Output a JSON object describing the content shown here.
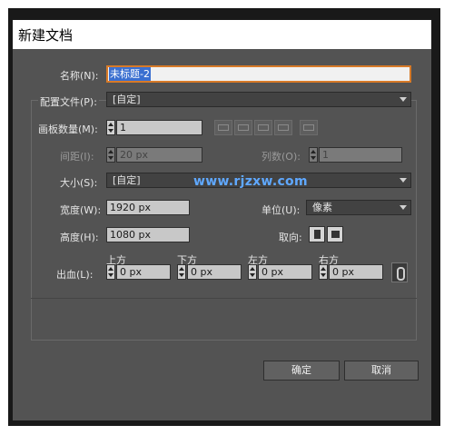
{
  "window": {
    "title": "新建文档"
  },
  "form": {
    "name": {
      "label": "名称(N):",
      "value": "未标题-2"
    },
    "profile": {
      "label": "配置文件(P):",
      "value": "[自定]"
    },
    "artboards": {
      "label": "画板数量(M):",
      "value": "1"
    },
    "spacing": {
      "label": "间距(I):",
      "value": "20 px"
    },
    "columns": {
      "label": "列数(O):",
      "value": "1"
    },
    "size": {
      "label": "大小(S):",
      "value": "[自定]"
    },
    "width": {
      "label": "宽度(W):",
      "value": "1920 px"
    },
    "units": {
      "label": "单位(U):",
      "value": "像素"
    },
    "height": {
      "label": "高度(H):",
      "value": "1080 px"
    },
    "orientation": {
      "label": "取向:"
    },
    "bleed": {
      "label": "出血(L):",
      "top": {
        "label": "上方",
        "value": "0 px"
      },
      "bottom": {
        "label": "下方",
        "value": "0 px"
      },
      "left": {
        "label": "左方",
        "value": "0 px"
      },
      "right": {
        "label": "右方",
        "value": "0 px"
      }
    }
  },
  "buttons": {
    "ok": "确定",
    "cancel": "取消"
  },
  "watermark": "www.rjzxw.com",
  "colors": {
    "dialog_bg": "#535353",
    "name_focus": "#d77a28",
    "selection": "#3a6fd0",
    "watermark": "#5fa8ff"
  },
  "icons": [
    "arrange-grid-by-row-icon",
    "arrange-grid-by-column-icon",
    "arrange-by-row-icon",
    "arrange-by-column-icon",
    "change-to-rtl-icon",
    "portrait-icon",
    "landscape-icon",
    "link-icon"
  ]
}
